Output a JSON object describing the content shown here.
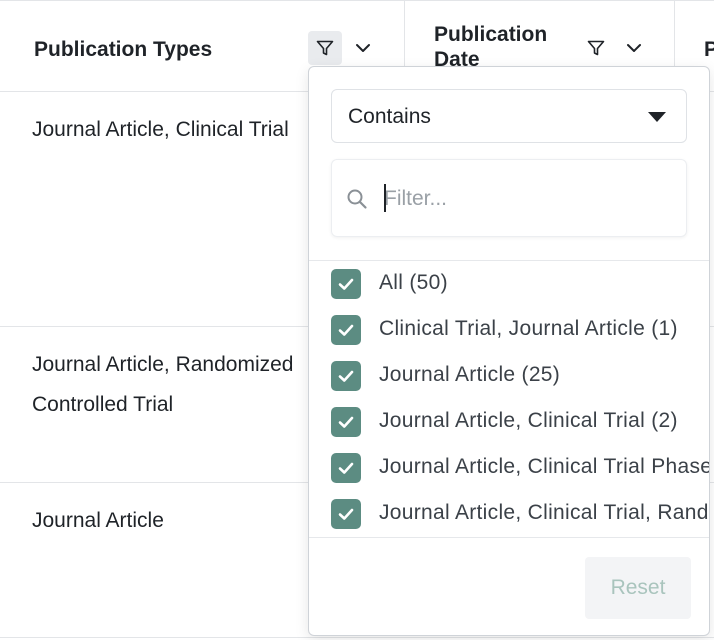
{
  "table": {
    "columns": [
      {
        "title": "Publication Types"
      },
      {
        "title": "Publication Date"
      },
      {
        "title": "P"
      }
    ],
    "rows": [
      {
        "publication_types": "Journal Article, Clinical Trial"
      },
      {
        "publication_types": "Journal Article, Randomized Controlled Trial"
      },
      {
        "publication_types": "Journal Article"
      }
    ]
  },
  "filter_popup": {
    "operator_selected": "Contains",
    "search_placeholder": "Filter...",
    "items": [
      {
        "label": "All (50)",
        "checked": true
      },
      {
        "label": "Clinical Trial, Journal Article (1)",
        "checked": true
      },
      {
        "label": "Journal Article (25)",
        "checked": true
      },
      {
        "label": "Journal Article, Clinical Trial (2)",
        "checked": true
      },
      {
        "label": "Journal Article, Clinical Trial Phase",
        "checked": true
      },
      {
        "label": "Journal Article, Clinical Trial, Randomized",
        "checked": true
      }
    ],
    "reset_label": "Reset"
  },
  "colors": {
    "checkbox_checked": "#5c8c82",
    "reset_text_disabled": "#a9c4bd",
    "border": "#e3e5e8"
  },
  "icons": {
    "column_filter": "funnel-icon",
    "column_menu": "chevron-down-icon",
    "search": "search-icon",
    "dropdown": "caret-down-icon",
    "checkbox": "checkmark-icon"
  }
}
